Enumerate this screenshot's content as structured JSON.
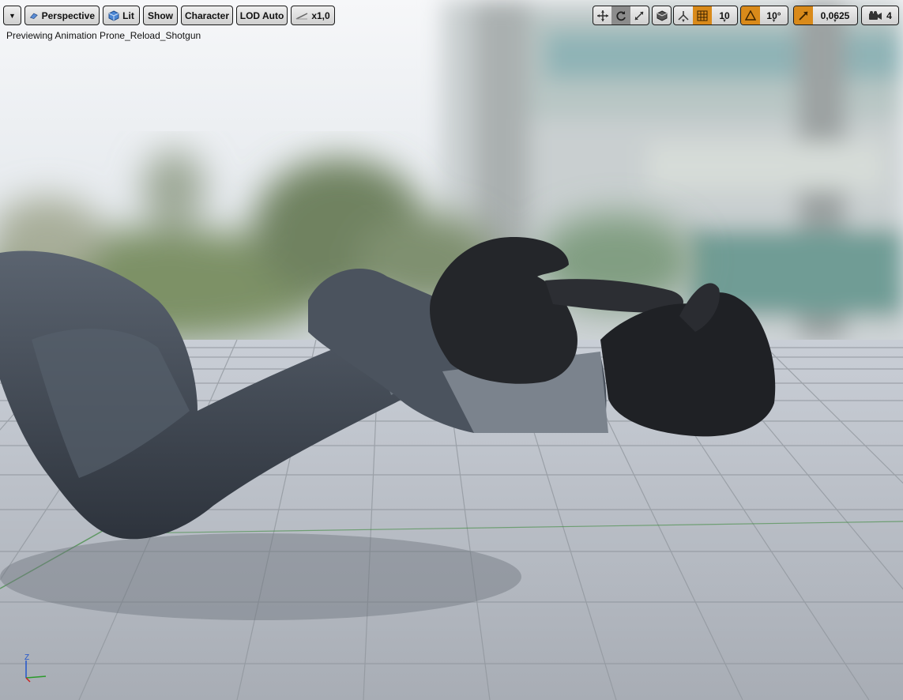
{
  "toolbar": {
    "perspective_label": "Perspective",
    "lit_label": "Lit",
    "show_label": "Show",
    "character_label": "Character",
    "lod_label": "LOD Auto",
    "play_rate_label": "x1,0",
    "grid_snap_value": "10",
    "rotation_snap_value": "10°",
    "scale_snap_value": "0,0625",
    "camera_speed_value": "4"
  },
  "viewport": {
    "preview_text": "Previewing Animation Prone_Reload_Shotgun",
    "axis_z_label": "Z"
  },
  "icons": {
    "menu": "chevron-down-icon",
    "perspective": "perspective-icon",
    "lit": "lit-cube-icon",
    "play_rate": "play-rate-icon",
    "translate": "translate-icon",
    "rotate": "rotate-icon",
    "scale": "scale-icon",
    "surface_snap": "surface-snap-icon",
    "world_local": "world-local-icon",
    "grid_snap": "grid-snap-icon",
    "rotation_snap": "rotation-snap-icon",
    "scale_snap": "scale-snap-icon",
    "camera_speed": "camera-speed-icon"
  },
  "colors": {
    "toolbar_button": "#dcdcdc",
    "snap_active": "#d98a1a",
    "sky": "#e9edf2",
    "floor": "#b4bac2",
    "floor_grid": "#8f959c",
    "sleeve": "#3a414c",
    "glove": "#222428"
  }
}
